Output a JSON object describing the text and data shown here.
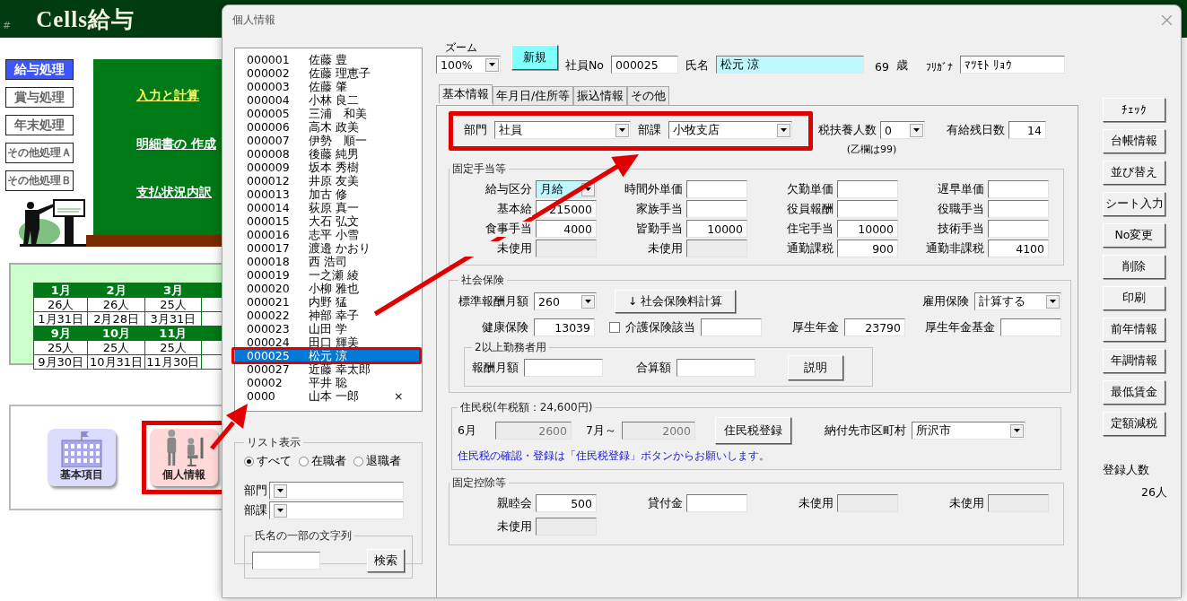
{
  "background_app": {
    "mark": "#",
    "title": "Cells給与",
    "nav": [
      {
        "label": "給与処理",
        "selected": true
      },
      {
        "label": "賞与処理",
        "selected": false
      },
      {
        "label": "年末処理",
        "selected": false
      },
      {
        "label": "その他処理Ａ",
        "selected": false
      },
      {
        "label": "その他処理Ｂ",
        "selected": false
      }
    ],
    "board_links": [
      {
        "label": "入力と計算",
        "selected": true
      },
      {
        "label": "明細書の 作成",
        "selected": false
      },
      {
        "label": "支払状況内訳",
        "selected": false
      }
    ],
    "calendar": [
      {
        "months": [
          "1月",
          "2月",
          "3月"
        ],
        "counts": [
          "26人",
          "26人",
          "25人"
        ],
        "dates": [
          "1月31日",
          "2月28日",
          "3月31日"
        ]
      },
      {
        "months": [
          "9月",
          "10月",
          "11月"
        ],
        "counts": [
          "25人",
          "25人",
          "25人"
        ],
        "dates": [
          "9月30日",
          "10月31日",
          "11月30日"
        ]
      }
    ],
    "launchers": [
      {
        "label": "基本項目",
        "kind": "building",
        "highlighted": false
      },
      {
        "label": "個人情報",
        "kind": "people",
        "highlighted": true
      }
    ]
  },
  "dialog": {
    "title": "個人情報",
    "employees": [
      {
        "id": "000001",
        "name": "佐藤 豊",
        "selected": false
      },
      {
        "id": "000002",
        "name": "佐藤 理恵子",
        "selected": false
      },
      {
        "id": "000003",
        "name": "佐藤 肇",
        "selected": false
      },
      {
        "id": "000004",
        "name": "小林 良二",
        "selected": false
      },
      {
        "id": "000005",
        "name": "三浦　和美",
        "selected": false
      },
      {
        "id": "000006",
        "name": "高木 政美",
        "selected": false
      },
      {
        "id": "000007",
        "name": "伊勢　順一",
        "selected": false
      },
      {
        "id": "000008",
        "name": "後藤 純男",
        "selected": false
      },
      {
        "id": "000009",
        "name": "坂本 秀樹",
        "selected": false
      },
      {
        "id": "000012",
        "name": "井原 友美",
        "selected": false
      },
      {
        "id": "000013",
        "name": "加古 修",
        "selected": false
      },
      {
        "id": "000014",
        "name": "荻原 真一",
        "selected": false
      },
      {
        "id": "000015",
        "name": "大石 弘文",
        "selected": false
      },
      {
        "id": "000016",
        "name": "志平 小雪",
        "selected": false
      },
      {
        "id": "000017",
        "name": "渡邉 かおり",
        "selected": false
      },
      {
        "id": "000018",
        "name": "西 浩司",
        "selected": false
      },
      {
        "id": "000019",
        "name": "一之瀬 綾",
        "selected": false
      },
      {
        "id": "000020",
        "name": "小柳 雅也",
        "selected": false
      },
      {
        "id": "000021",
        "name": "内野 猛",
        "selected": false
      },
      {
        "id": "000022",
        "name": "神部 幸子",
        "selected": false
      },
      {
        "id": "000023",
        "name": "山田 学",
        "selected": false
      },
      {
        "id": "000024",
        "name": "田口 輝美",
        "selected": false
      },
      {
        "id": "000025",
        "name": "松元 涼",
        "selected": true
      },
      {
        "id": "000027",
        "name": "近藤 幸太郎",
        "selected": false
      },
      {
        "id": "00002",
        "name": "平井 聡",
        "selected": false
      },
      {
        "id": "0000",
        "name": "山本 一郎",
        "selected": false,
        "mark": "×"
      }
    ],
    "list_filter": {
      "title": "リスト表示",
      "options": [
        {
          "label": "すべて",
          "selected": true
        },
        {
          "label": "在職者",
          "selected": false
        },
        {
          "label": "退職者",
          "selected": false
        }
      ],
      "selects": [
        {
          "label": "部門"
        },
        {
          "label": "部課"
        }
      ],
      "name_search": {
        "title": "氏名の一部の文字列",
        "button": "検索"
      }
    },
    "header": {
      "zoom": {
        "label": "ズーム",
        "value": "100%"
      },
      "new_button": "新規",
      "employee_no": {
        "label": "社員No",
        "value": "000025"
      },
      "name": {
        "label": "氏名",
        "value": "松元 涼"
      },
      "age": {
        "value": "69",
        "unit": "歳"
      },
      "furigana": {
        "label": "ﾌﾘｶﾞﾅ",
        "value": "ﾏﾂﾓﾄ ﾘｮｳ"
      }
    },
    "tabs": [
      {
        "label": "基本情報",
        "selected": true
      },
      {
        "label": "年月日/住所等",
        "selected": false
      },
      {
        "label": "振込情報",
        "selected": false
      },
      {
        "label": "その他",
        "selected": false
      }
    ],
    "department": {
      "label": "部門",
      "value": "社員"
    },
    "section": {
      "label": "部課",
      "value": "小牧支店"
    },
    "dependents": {
      "label": "税扶養人数",
      "value": "0",
      "note": "(乙欄は99)"
    },
    "paid_leave": {
      "label": "有給残日数",
      "value": "14"
    },
    "allowances": {
      "title": "固定手当等",
      "fields": [
        {
          "label": "給与区分",
          "value": "月給",
          "kind": "select",
          "highlighted": true
        },
        {
          "label": "時間外単価",
          "kind": "input"
        },
        {
          "label": "欠勤単価",
          "kind": "input"
        },
        {
          "label": "遅早単価",
          "kind": "input"
        },
        {
          "label": "基本給",
          "value": "215000",
          "kind": "input"
        },
        {
          "label": "家族手当",
          "kind": "input"
        },
        {
          "label": "役員報酬",
          "kind": "input"
        },
        {
          "label": "役職手当",
          "kind": "input"
        },
        {
          "label": "食事手当",
          "value": "4000",
          "kind": "input"
        },
        {
          "label": "皆勤手当",
          "value": "10000",
          "kind": "input"
        },
        {
          "label": "住宅手当",
          "value": "10000",
          "kind": "input"
        },
        {
          "label": "技術手当",
          "kind": "input"
        },
        {
          "label": "未使用",
          "kind": "unused"
        },
        {
          "label": "未使用",
          "kind": "unused"
        },
        {
          "label": "通勤課税",
          "value": "900",
          "kind": "input"
        },
        {
          "label": "通勤非課税",
          "value": "4100",
          "kind": "input"
        }
      ]
    },
    "social_insurance": {
      "title": "社会保険",
      "standard_pay": {
        "label": "標準報酬月額",
        "value": "260"
      },
      "calc_button": "↓  社会保険料計算",
      "employment_insurance": {
        "label": "雇用保険",
        "value": "計算する"
      },
      "health": {
        "label": "健康保険",
        "value": "13039"
      },
      "nursing": {
        "label": "介護保険該当",
        "checked": false
      },
      "pension": {
        "label": "厚生年金",
        "value": "23790"
      },
      "pension_fund": {
        "label": "厚生年金基金"
      },
      "multi_work": {
        "title": "2以上勤務者用",
        "fields": [
          {
            "label": "報酬月額"
          },
          {
            "label": "合算額"
          }
        ],
        "button": "説明"
      }
    },
    "resident_tax": {
      "title": "住民税(年税額：24,600円)",
      "june": {
        "label": "6月",
        "value": "2600"
      },
      "july": {
        "label": "7月～",
        "value": "2000"
      },
      "button": "住民税登録",
      "city": {
        "label": "納付先市区町村",
        "value": "所沢市"
      },
      "note": "住民税の確認・登録は「住民税登録」ボタンからお願いします。"
    },
    "deductions": {
      "title": "固定控除等",
      "fields": [
        {
          "label": "親睦会",
          "value": "500",
          "kind": "input"
        },
        {
          "label": "貸付金",
          "kind": "input"
        },
        {
          "label": "未使用",
          "kind": "unused"
        },
        {
          "label": "未使用",
          "kind": "unused"
        },
        {
          "label": "未使用",
          "kind": "unused"
        }
      ]
    },
    "side_buttons": [
      "ﾁｪｯｸ",
      "台帳情報",
      "並び替え",
      "シート入力",
      "No変更",
      "削除",
      "印刷",
      "前年情報",
      "年調情報",
      "最低賃金",
      "定額減税"
    ],
    "registered": {
      "label": "登録人数",
      "value": "26人"
    }
  }
}
